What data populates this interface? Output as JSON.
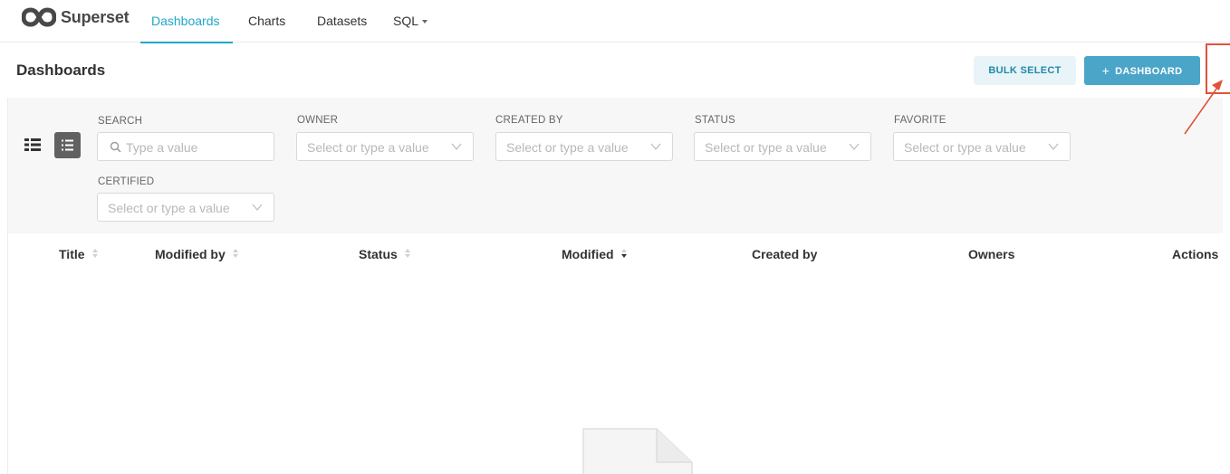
{
  "app": {
    "name": "Superset",
    "brand_color": "#20a7c9",
    "logo_icon": "infinity-logo-icon"
  },
  "nav": {
    "items": [
      {
        "label": "Dashboards",
        "active": true
      },
      {
        "label": "Charts",
        "active": false
      },
      {
        "label": "Datasets",
        "active": false
      },
      {
        "label": "SQL",
        "active": false,
        "has_dropdown": true
      }
    ]
  },
  "header": {
    "title": "Dashboards",
    "bulk_select_label": "BULK SELECT",
    "add_button_label": "DASHBOARD",
    "add_button_icon": "plus-icon"
  },
  "view_toggle": {
    "options": [
      "card-view-icon",
      "list-view-icon"
    ],
    "selected": "list-view-icon"
  },
  "filters": {
    "search": {
      "label": "SEARCH",
      "placeholder": "Type a value"
    },
    "owner": {
      "label": "OWNER",
      "placeholder": "Select or type a value"
    },
    "created_by": {
      "label": "CREATED BY",
      "placeholder": "Select or type a value"
    },
    "status": {
      "label": "STATUS",
      "placeholder": "Select or type a value"
    },
    "favorite": {
      "label": "FAVORITE",
      "placeholder": "Select or type a value"
    },
    "certified": {
      "label": "CERTIFIED",
      "placeholder": "Select or type a value"
    }
  },
  "table": {
    "columns": [
      {
        "label": "Title",
        "sortable": true,
        "sorted": null
      },
      {
        "label": "Modified by",
        "sortable": true,
        "sorted": null
      },
      {
        "label": "Status",
        "sortable": true,
        "sorted": null
      },
      {
        "label": "Modified",
        "sortable": true,
        "sorted": "desc"
      },
      {
        "label": "Created by",
        "sortable": false,
        "sorted": null
      },
      {
        "label": "Owners",
        "sortable": false,
        "sorted": null
      },
      {
        "label": "Actions",
        "sortable": false,
        "sorted": null
      }
    ],
    "rows": []
  },
  "colors": {
    "accent": "#20a7c9",
    "primary_button": "#4aa5c9",
    "annotation": "#e0523a"
  }
}
